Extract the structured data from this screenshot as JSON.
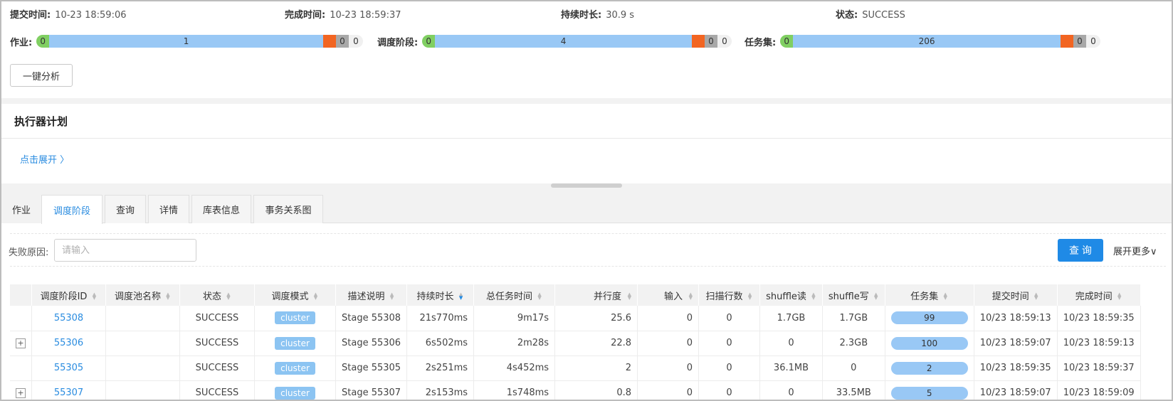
{
  "summary": {
    "submit_label": "提交时间:",
    "submit_value": "10-23 18:59:06",
    "finish_label": "完成时间:",
    "finish_value": "10-23 18:59:37",
    "duration_label": "持续时长:",
    "duration_value": "30.9 s",
    "status_label": "状态:",
    "status_value": "SUCCESS"
  },
  "progress": [
    {
      "label": "作业:",
      "green": "0",
      "blue": "1",
      "orange": "0",
      "gray": "0",
      "white": "0"
    },
    {
      "label": "调度阶段:",
      "green": "0",
      "blue": "4",
      "orange": "0",
      "gray": "0",
      "white": "0"
    },
    {
      "label": "任务集:",
      "green": "0",
      "blue": "206",
      "orange": "0",
      "gray": "0",
      "white": "0"
    }
  ],
  "analyze_button": "一键分析",
  "executor": {
    "title": "执行器计划",
    "expand_link": "点击展开 〉"
  },
  "tabs": [
    "作业",
    "调度阶段",
    "查询",
    "详情",
    "库表信息",
    "事务关系图"
  ],
  "active_tab": 1,
  "filter": {
    "label": "失败原因:",
    "placeholder": "请输入",
    "value": "",
    "query_button": "查 询",
    "expand_more": "展开更多∨"
  },
  "table": {
    "columns": [
      "调度阶段ID",
      "调度池名称",
      "状态",
      "调度模式",
      "描述说明",
      "持续时长",
      "总任务时间",
      "并行度",
      "输入",
      "扫描行数",
      "shuffle读",
      "shuffle写",
      "任务集",
      "提交时间",
      "完成时间"
    ],
    "sorted_column": 5,
    "rows": [
      {
        "expand": "",
        "id": "55308",
        "pool": "",
        "status": "SUCCESS",
        "mode": "cluster",
        "desc": "Stage 55308",
        "duration": "21s770ms",
        "total": "9m17s",
        "parallel": "25.6",
        "input": "0",
        "scan": "0",
        "sread": "1.7GB",
        "swrite": "1.7GB",
        "tasks": "99",
        "submit": "10/23 18:59:13",
        "finish": "10/23 18:59:35"
      },
      {
        "expand": "+",
        "id": "55306",
        "pool": "",
        "status": "SUCCESS",
        "mode": "cluster",
        "desc": "Stage 55306",
        "duration": "6s502ms",
        "total": "2m28s",
        "parallel": "22.8",
        "input": "0",
        "scan": "0",
        "sread": "0",
        "swrite": "2.3GB",
        "tasks": "100",
        "submit": "10/23 18:59:07",
        "finish": "10/23 18:59:13"
      },
      {
        "expand": "",
        "id": "55305",
        "pool": "",
        "status": "SUCCESS",
        "mode": "cluster",
        "desc": "Stage 55305",
        "duration": "2s251ms",
        "total": "4s452ms",
        "parallel": "2",
        "input": "0",
        "scan": "0",
        "sread": "36.1MB",
        "swrite": "0",
        "tasks": "2",
        "submit": "10/23 18:59:35",
        "finish": "10/23 18:59:37"
      },
      {
        "expand": "+",
        "id": "55307",
        "pool": "",
        "status": "SUCCESS",
        "mode": "cluster",
        "desc": "Stage 55307",
        "duration": "2s153ms",
        "total": "1s748ms",
        "parallel": "0.8",
        "input": "0",
        "scan": "0",
        "sread": "0",
        "swrite": "33.5MB",
        "tasks": "5",
        "submit": "10/23 18:59:07",
        "finish": "10/23 18:59:09"
      }
    ]
  }
}
